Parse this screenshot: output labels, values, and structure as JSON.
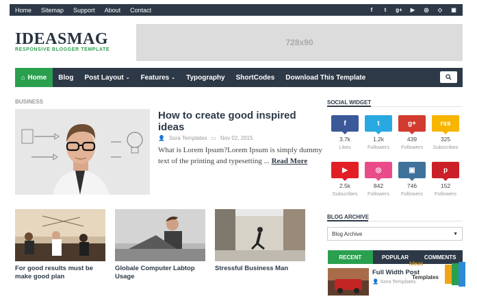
{
  "topbar": {
    "links": [
      "Home",
      "Sitemap",
      "Support",
      "About",
      "Contact"
    ],
    "social_icons": [
      "facebook-icon",
      "twitter-icon",
      "google-plus-icon",
      "youtube-icon",
      "dribbble-icon",
      "codepen-icon",
      "instagram-icon"
    ]
  },
  "header": {
    "logo_part1": "IDEAS",
    "logo_part2": "MAG",
    "logo_sub": "RESPONSIVE BLOGGER TEMPLATE",
    "ad_text": "728x90"
  },
  "nav": {
    "home": "Home",
    "blog": "Blog",
    "post_layout": "Post Layout",
    "features": "Features",
    "typography": "Typography",
    "shortcodes": "ShortCodes",
    "download": "Download This Template"
  },
  "featured": {
    "label": "BUSINESS",
    "title": "How to create good inspired ideas",
    "author": "Sora Templates",
    "date": "Nov 02, 2015",
    "excerpt": "What is Lorem Ipsum?Lorem Ipsum is simply dummy text of the printing and typesetting ...",
    "read_more": "Read More"
  },
  "cards": [
    {
      "title": "For good results must be make good plan"
    },
    {
      "title": "Globale Computer Labtop Usage"
    },
    {
      "title": "Stressful Business Man"
    }
  ],
  "sidebar": {
    "social_widget_title": "SOCIAL WIDGET",
    "social": [
      {
        "icon": "facebook-icon",
        "glyph": "f",
        "count": "3.7k",
        "label": "Likes",
        "color": "#3b5998"
      },
      {
        "icon": "twitter-icon",
        "glyph": "t",
        "count": "1.2k",
        "label": "Followers",
        "color": "#29a9e1"
      },
      {
        "icon": "google-plus-icon",
        "glyph": "g+",
        "count": "439",
        "label": "Followers",
        "color": "#d23b2f"
      },
      {
        "icon": "rss-icon",
        "glyph": "rss",
        "count": "325",
        "label": "Subscribes",
        "color": "#f7b500"
      },
      {
        "icon": "youtube-icon",
        "glyph": "▶",
        "count": "2.5k",
        "label": "Subscribes",
        "color": "#e31f26"
      },
      {
        "icon": "dribbble-icon",
        "glyph": "◎",
        "count": "842",
        "label": "Followers",
        "color": "#ea4c89"
      },
      {
        "icon": "instagram-icon",
        "glyph": "▣",
        "count": "746",
        "label": "Followers",
        "color": "#3f729b"
      },
      {
        "icon": "pinterest-icon",
        "glyph": "p",
        "count": "152",
        "label": "Followers",
        "color": "#cb2027"
      }
    ],
    "archive_title": "BLOG ARCHIVE",
    "archive_select": "Blog Archive",
    "tabs": [
      "RECENT",
      "POPULAR",
      "COMMENTS"
    ],
    "recent_post_title": "Full Width Post",
    "recent_post_author": "Sora Templates",
    "watermark_1": "Ideas",
    "watermark_2": "Templates"
  },
  "colors": {
    "dark": "#2d3947",
    "accent_green": "#2aa04f",
    "ad_gray": "#dcdcdc"
  }
}
